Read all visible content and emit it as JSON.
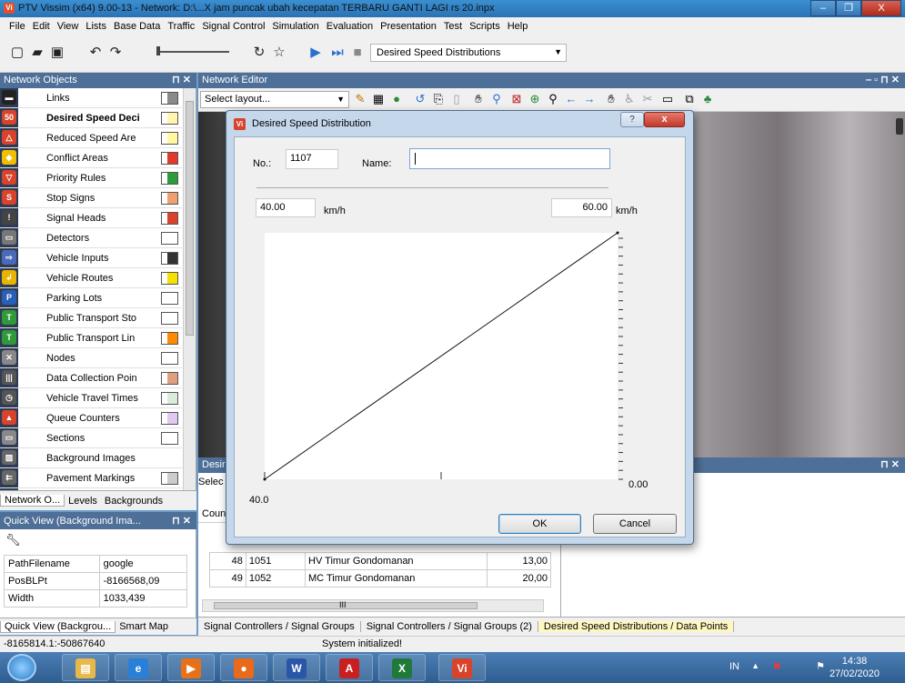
{
  "window": {
    "title": "PTV Vissim (x64) 9.00-13 - Network: D:\\...X jam puncak ubah kecepatan TERBARU GANTI LAGI  rs 20.inpx",
    "app_icon_text": "Vi",
    "buttons": [
      "–",
      "❐",
      "X"
    ]
  },
  "menu": [
    "File",
    "Edit",
    "View",
    "Lists",
    "Base Data",
    "Traffic",
    "Signal Control",
    "Simulation",
    "Evaluation",
    "Presentation",
    "Test",
    "Scripts",
    "Help"
  ],
  "toolbar": {
    "list_dropdown": "Desired Speed Distributions"
  },
  "network_objects": {
    "header": "Network Objects",
    "items": [
      {
        "label": "Links",
        "icon": "links-icon",
        "icon_color": "#222222",
        "swatch": "#8a8a8a"
      },
      {
        "label": "Desired Speed Deci",
        "icon": "speed-50-icon",
        "icon_color": "#d9432b",
        "swatch": "#fff5b0",
        "selected": true
      },
      {
        "label": "Reduced Speed Are",
        "icon": "reduced-speed-icon",
        "icon_color": "#d9432b",
        "swatch": "#fff8a0"
      },
      {
        "label": "Conflict Areas",
        "icon": "conflict-areas-icon",
        "icon_color": "#f0c000",
        "swatch": "#e23a2a"
      },
      {
        "label": "Priority Rules",
        "icon": "priority-rules-icon",
        "icon_color": "#d9432b",
        "swatch": "#2e9a3a"
      },
      {
        "label": "Stop Signs",
        "icon": "stop-sign-icon",
        "icon_color": "#d9432b",
        "swatch": "#f0a070"
      },
      {
        "label": "Signal Heads",
        "icon": "signal-heads-icon",
        "icon_color": "#444444",
        "swatch": "#d9432b"
      },
      {
        "label": "Detectors",
        "icon": "detectors-icon",
        "icon_color": "#777777",
        "swatch": "#ffffff"
      },
      {
        "label": "Vehicle Inputs",
        "icon": "vehicle-inputs-icon",
        "icon_color": "#4a6ab8",
        "swatch": "#333333"
      },
      {
        "label": "Vehicle Routes",
        "icon": "vehicle-routes-icon",
        "icon_color": "#e8b400",
        "swatch": "#f5e000"
      },
      {
        "label": "Parking Lots",
        "icon": "parking-lots-icon",
        "icon_color": "#2a5fb8",
        "swatch": "#ffffff"
      },
      {
        "label": "Public Transport Sto",
        "icon": "pt-stops-icon",
        "icon_color": "#2e9a3a",
        "swatch": "#ffffff"
      },
      {
        "label": "Public Transport Lin",
        "icon": "pt-lines-icon",
        "icon_color": "#2e9a3a",
        "swatch": "#ff8a00"
      },
      {
        "label": "Nodes",
        "icon": "nodes-icon",
        "icon_color": "#888888",
        "swatch": "#ffffff"
      },
      {
        "label": "Data Collection Poin",
        "icon": "data-collection-icon",
        "icon_color": "#555555",
        "swatch": "#e0a080"
      },
      {
        "label": "Vehicle Travel Times",
        "icon": "travel-times-icon",
        "icon_color": "#555555",
        "swatch": "#d8ecd8"
      },
      {
        "label": "Queue Counters",
        "icon": "queue-counters-icon",
        "icon_color": "#d9432b",
        "swatch": "#e0c8f0"
      },
      {
        "label": "Sections",
        "icon": "sections-icon",
        "icon_color": "#888888",
        "swatch": "#ffffff"
      },
      {
        "label": "Background Images",
        "icon": "background-images-icon",
        "icon_color": "#666666",
        "swatch": null
      },
      {
        "label": "Pavement Markings",
        "icon": "pavement-markings-icon",
        "icon_color": "#666666",
        "swatch": "#cccccc"
      }
    ],
    "tabs": [
      "Network O...",
      "Levels",
      "Backgrounds"
    ]
  },
  "quick_view": {
    "header": "Quick View (Background Ima...",
    "rows": [
      {
        "key": "PathFilename",
        "value": "google"
      },
      {
        "key": "PosBLPt",
        "value": "-8166568,09"
      },
      {
        "key": "Width",
        "value": "1033,439"
      }
    ],
    "tabs": [
      "Quick View (Backgrou...",
      "Smart Map"
    ]
  },
  "network_editor": {
    "header": "Network Editor",
    "layout_placeholder": "Select layout..."
  },
  "lower_panel": {
    "header": "Desir",
    "select": "Selec",
    "count_label": "Coun",
    "rows": [
      {
        "index": "48",
        "no": "1051",
        "name": "HV Timur Gondomanan",
        "value": "13,00"
      },
      {
        "index": "49",
        "no": "1052",
        "name": "MC Timur Gondomanan",
        "value": "20,00"
      }
    ],
    "scroll_marker": "III",
    "tabs": [
      "Signal Controllers / Signal Groups",
      "Signal Controllers / Signal Groups (2)",
      "Desired Speed Distributions / Data Points"
    ]
  },
  "status": {
    "coords": "-8165814.1:-50867640",
    "message": "System initialized!"
  },
  "taskbar": {
    "language": "IN",
    "time": "14:38",
    "date": "27/02/2020",
    "apps": [
      {
        "icon": "explorer-icon",
        "color": "#e8b848",
        "glyph": "▤"
      },
      {
        "icon": "ie-icon",
        "color": "#2a7fd8",
        "glyph": "e"
      },
      {
        "icon": "media-icon",
        "color": "#e8701a",
        "glyph": "▶"
      },
      {
        "icon": "firefox-icon",
        "color": "#e86a1a",
        "glyph": "●"
      },
      {
        "icon": "word-icon",
        "color": "#2a56a8",
        "glyph": "W"
      },
      {
        "icon": "acrobat-icon",
        "color": "#c82020",
        "glyph": "A"
      },
      {
        "icon": "excel-icon",
        "color": "#1f7a3a",
        "glyph": "X"
      },
      {
        "icon": "vissim-icon",
        "color": "#d9432b",
        "glyph": "Vi"
      }
    ]
  },
  "dialog": {
    "title": "Desired Speed Distribution",
    "help_label": "?",
    "close_label": "x",
    "no_label": "No.:",
    "no_value": "1107",
    "name_label": "Name:",
    "name_value": "",
    "min_speed": "40.00",
    "max_speed": "60.00",
    "unit": "km/h",
    "x_min_label": "40.0",
    "y_min_label": "0.00",
    "ok_label": "OK",
    "cancel_label": "Cancel"
  },
  "chart_data": {
    "type": "line",
    "title": "",
    "xlabel": "",
    "ylabel": "",
    "x": [
      40.0,
      60.0
    ],
    "y": [
      0.0,
      1.0
    ],
    "xlim": [
      40.0,
      60.0
    ],
    "ylim": [
      0.0,
      1.0
    ],
    "y_tick_count": 28,
    "x_tick_at": 50.0
  }
}
